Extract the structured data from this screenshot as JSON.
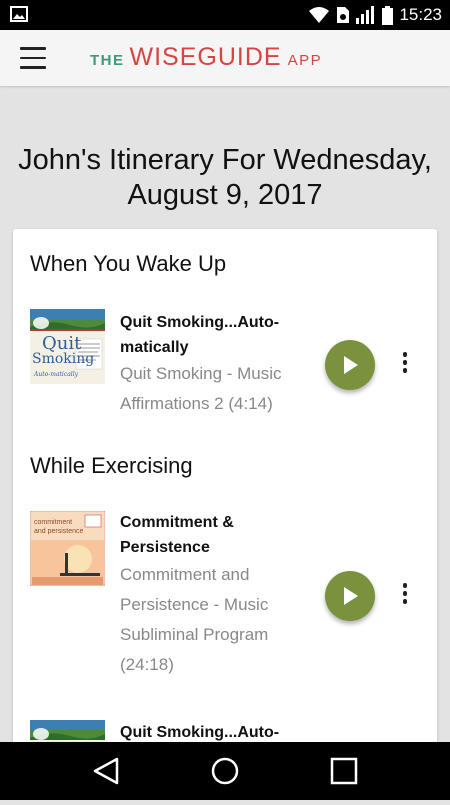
{
  "status_bar": {
    "time": "15:23"
  },
  "app_bar": {
    "logo": {
      "the": "THE",
      "wise": "WISE",
      "guide": "GUIDE",
      "app": "APP"
    }
  },
  "itinerary": {
    "title_line1": "John's Itinerary For Wednesday,",
    "title_line2": "August 9, 2017"
  },
  "sections": [
    {
      "title": "When You Wake Up",
      "track": {
        "title_line1": "Quit Smoking...Auto-",
        "title_line2": "matically",
        "subtitle_line1": "Quit Smoking - Music",
        "subtitle_line2": "Affirmations 2 (4:14)",
        "cover": {
          "top_text": "Quit",
          "bottom_text": "Smoking",
          "script": "Auto-matically"
        }
      }
    },
    {
      "title": "While Exercising",
      "track": {
        "title_line1": "Commitment &",
        "title_line2": "Persistence",
        "subtitle_line1": "Commitment and",
        "subtitle_line2": "Persistence - Music",
        "subtitle_line3": "Subliminal Program",
        "subtitle_line4": "(24:18)",
        "cover": {
          "line1": "commitment",
          "line2": "and persistence"
        }
      }
    },
    {
      "track": {
        "title_line1": "Quit Smoking...Auto-"
      }
    }
  ],
  "colors": {
    "accent": "#7a913e",
    "brand_red": "#d64541",
    "brand_teal": "#3d9a7a"
  }
}
